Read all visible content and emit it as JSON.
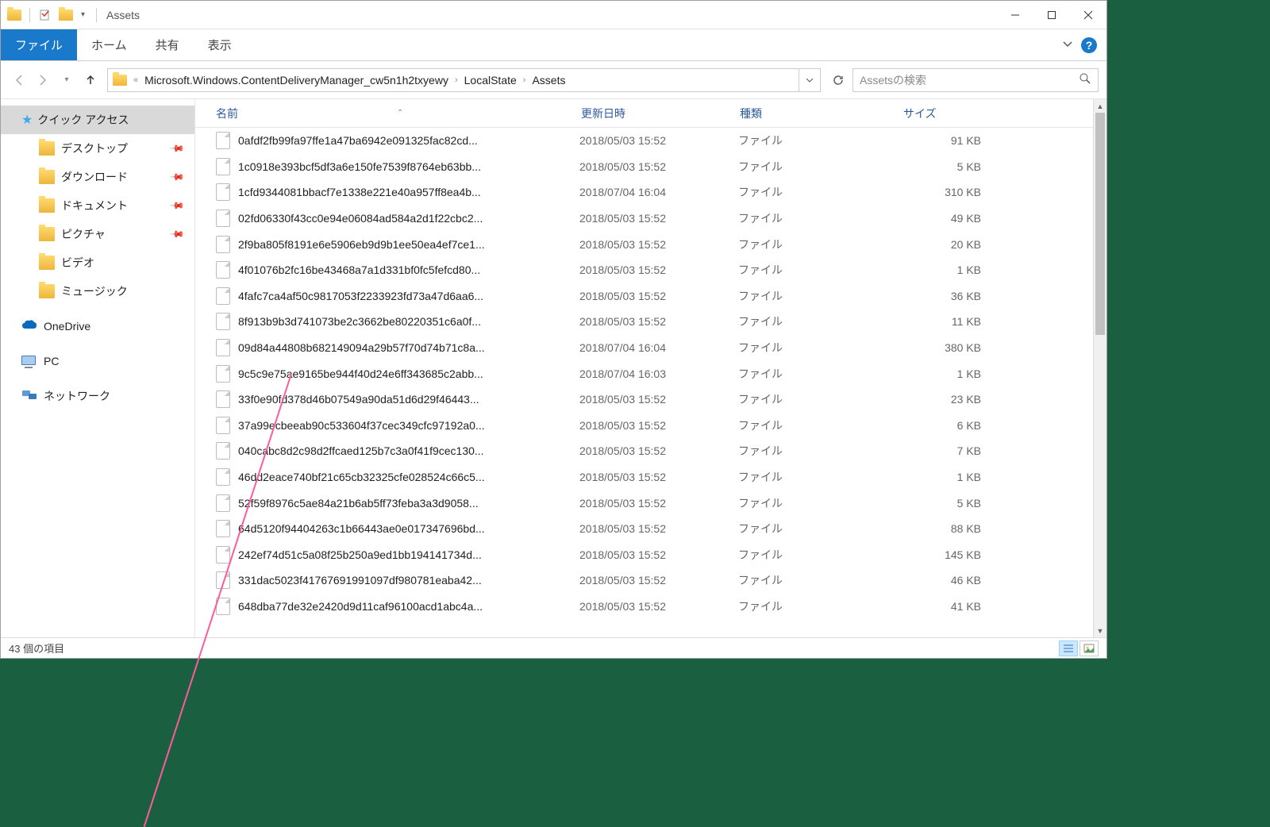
{
  "titlebar": {
    "title": "Assets"
  },
  "ribbon": {
    "file": "ファイル",
    "home": "ホーム",
    "share": "共有",
    "view": "表示"
  },
  "breadcrumb": {
    "prefix": "«",
    "parts": [
      "Microsoft.Windows.ContentDeliveryManager_cw5n1h2txyewy",
      "LocalState",
      "Assets"
    ]
  },
  "search": {
    "placeholder": "Assetsの検索"
  },
  "sidebar": {
    "quick_access": "クイック アクセス",
    "desktop": "デスクトップ",
    "downloads": "ダウンロード",
    "documents": "ドキュメント",
    "pictures": "ピクチャ",
    "videos": "ビデオ",
    "music": "ミュージック",
    "onedrive": "OneDrive",
    "pc": "PC",
    "network": "ネットワーク"
  },
  "columns": {
    "name": "名前",
    "date": "更新日時",
    "type": "種類",
    "size": "サイズ"
  },
  "files": [
    {
      "name": "0afdf2fb99fa97ffe1a47ba6942e091325fac82cd...",
      "date": "2018/05/03 15:52",
      "type": "ファイル",
      "size": "91 KB"
    },
    {
      "name": "1c0918e393bcf5df3a6e150fe7539f8764eb63bb...",
      "date": "2018/05/03 15:52",
      "type": "ファイル",
      "size": "5 KB"
    },
    {
      "name": "1cfd9344081bbacf7e1338e221e40a957ff8ea4b...",
      "date": "2018/07/04 16:04",
      "type": "ファイル",
      "size": "310 KB"
    },
    {
      "name": "02fd06330f43cc0e94e06084ad584a2d1f22cbc2...",
      "date": "2018/05/03 15:52",
      "type": "ファイル",
      "size": "49 KB"
    },
    {
      "name": "2f9ba805f8191e6e5906eb9d9b1ee50ea4ef7ce1...",
      "date": "2018/05/03 15:52",
      "type": "ファイル",
      "size": "20 KB"
    },
    {
      "name": "4f01076b2fc16be43468a7a1d331bf0fc5fefcd80...",
      "date": "2018/05/03 15:52",
      "type": "ファイル",
      "size": "1 KB"
    },
    {
      "name": "4fafc7ca4af50c9817053f2233923fd73a47d6aa6...",
      "date": "2018/05/03 15:52",
      "type": "ファイル",
      "size": "36 KB"
    },
    {
      "name": "8f913b9b3d741073be2c3662be80220351c6a0f...",
      "date": "2018/05/03 15:52",
      "type": "ファイル",
      "size": "11 KB"
    },
    {
      "name": "09d84a44808b682149094a29b57f70d74b71c8a...",
      "date": "2018/07/04 16:04",
      "type": "ファイル",
      "size": "380 KB"
    },
    {
      "name": "9c5c9e75ae9165be944f40d24e6ff343685c2abb...",
      "date": "2018/07/04 16:03",
      "type": "ファイル",
      "size": "1 KB"
    },
    {
      "name": "33f0e90fd378d46b07549a90da51d6d29f46443...",
      "date": "2018/05/03 15:52",
      "type": "ファイル",
      "size": "23 KB"
    },
    {
      "name": "37a99ecbeeab90c533604f37cec349cfc97192a0...",
      "date": "2018/05/03 15:52",
      "type": "ファイル",
      "size": "6 KB"
    },
    {
      "name": "040cabc8d2c98d2ffcaed125b7c3a0f41f9cec130...",
      "date": "2018/05/03 15:52",
      "type": "ファイル",
      "size": "7 KB"
    },
    {
      "name": "46dd2eace740bf21c65cb32325cfe028524c66c5...",
      "date": "2018/05/03 15:52",
      "type": "ファイル",
      "size": "1 KB"
    },
    {
      "name": "52f59f8976c5ae84a21b6ab5ff73feba3a3d9058...",
      "date": "2018/05/03 15:52",
      "type": "ファイル",
      "size": "5 KB"
    },
    {
      "name": "64d5120f94404263c1b66443ae0e017347696bd...",
      "date": "2018/05/03 15:52",
      "type": "ファイル",
      "size": "88 KB"
    },
    {
      "name": "242ef74d51c5a08f25b250a9ed1bb194141734d...",
      "date": "2018/05/03 15:52",
      "type": "ファイル",
      "size": "145 KB"
    },
    {
      "name": "331dac5023f4176769199109​7df980781eaba42...",
      "date": "2018/05/03 15:52",
      "type": "ファイル",
      "size": "46 KB"
    },
    {
      "name": "648dba77de32e2420d9d11caf96100acd1abc4a...",
      "date": "2018/05/03 15:52",
      "type": "ファイル",
      "size": "41 KB"
    }
  ],
  "status": {
    "count": "43 個の項目"
  }
}
